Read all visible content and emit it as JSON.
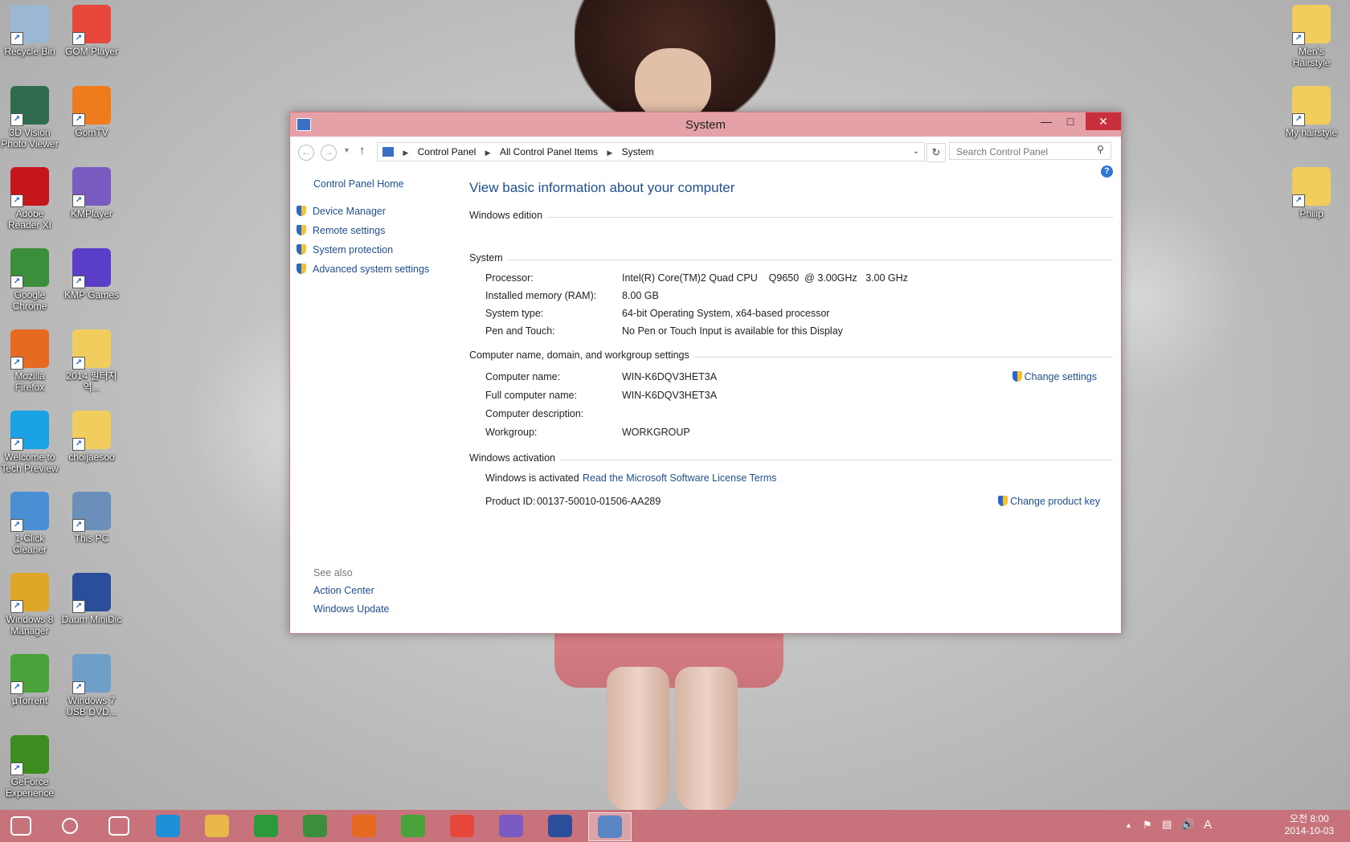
{
  "desktop": {
    "icons_left": [
      {
        "label": "Recycle Bin",
        "icon": "recycle-bin-icon",
        "color": "#9bb7d4"
      },
      {
        "label": "GOM Player",
        "icon": "gom-player-icon",
        "color": "#e8473b"
      },
      {
        "label": "3D Vision Photo Viewer",
        "icon": "3d-vision-icon",
        "color": "#2f6b4f"
      },
      {
        "label": "GomTV",
        "icon": "gomtv-icon",
        "color": "#f07b1d"
      },
      {
        "label": "Adobe Reader XI",
        "icon": "adobe-reader-icon",
        "color": "#c4161c"
      },
      {
        "label": "KMPlayer",
        "icon": "kmplayer-icon",
        "color": "#7a5bc2"
      },
      {
        "label": "Google Chrome",
        "icon": "chrome-icon",
        "color": "#3b8e3b"
      },
      {
        "label": "KMP Games",
        "icon": "kmp-games-icon",
        "color": "#5a3ec8"
      },
      {
        "label": "Mozilla Firefox",
        "icon": "firefox-icon",
        "color": "#e66a1f"
      },
      {
        "label": "2014 필터지역...",
        "icon": "folder-icon",
        "color": "#f0cd5c"
      },
      {
        "label": "Welcome to Tech Preview",
        "icon": "windows-logo-icon",
        "color": "#1aa1e6"
      },
      {
        "label": "choijaesoo",
        "icon": "user-folder-icon",
        "color": "#f0cd5c"
      },
      {
        "label": "1-Click Cleaner",
        "icon": "cleaner-icon",
        "color": "#4a8fd4"
      },
      {
        "label": "This PC",
        "icon": "this-pc-icon",
        "color": "#6a8fb8"
      },
      {
        "label": "Windows 8 Manager",
        "icon": "win8-manager-icon",
        "color": "#e0a628"
      },
      {
        "label": "Daum MiniDic",
        "icon": "daum-minidic-icon",
        "color": "#2a4e99"
      },
      {
        "label": "µTorrent",
        "icon": "utorrent-icon",
        "color": "#4aa23a"
      },
      {
        "label": "Windows 7 USB DVD...",
        "icon": "usb-dvd-tool-icon",
        "color": "#6f9fc9"
      },
      {
        "label": "GeForce Experience",
        "icon": "geforce-icon",
        "color": "#3c8c1f"
      }
    ],
    "icons_right": [
      {
        "label": "Men's Hairstyle",
        "icon": "folder-icon",
        "color": "#f0cd5c"
      },
      {
        "label": "My hairstyle",
        "icon": "folder-icon",
        "color": "#f0cd5c"
      },
      {
        "label": "Philip",
        "icon": "folder-icon",
        "color": "#f0cd5c"
      }
    ]
  },
  "window": {
    "title": "System",
    "address": {
      "crumbs": [
        "Control Panel",
        "All Control Panel Items",
        "System"
      ]
    },
    "search_placeholder": "Search Control Panel",
    "left": {
      "home": "Control Panel Home",
      "tasks": [
        "Device Manager",
        "Remote settings",
        "System protection",
        "Advanced system settings"
      ],
      "see_also": "See also",
      "links": [
        "Action Center",
        "Windows Update"
      ]
    },
    "main": {
      "heading": "View basic information about your computer",
      "edition_section": "Windows edition",
      "system_section": "System",
      "system_rows": [
        {
          "k": "Processor:",
          "v": "Intel(R) Core(TM)2 Quad CPU    Q9650  @ 3.00GHz   3.00 GHz"
        },
        {
          "k": "Installed memory (RAM):",
          "v": "8.00 GB"
        },
        {
          "k": "System type:",
          "v": "64-bit Operating System, x64-based processor"
        },
        {
          "k": "Pen and Touch:",
          "v": "No Pen or Touch Input is available for this Display"
        }
      ],
      "computer_section": "Computer name, domain, and workgroup settings",
      "computer_rows": [
        {
          "k": "Computer name:",
          "v": "WIN-K6DQV3HET3A"
        },
        {
          "k": "Full computer name:",
          "v": "WIN-K6DQV3HET3A"
        },
        {
          "k": "Computer description:",
          "v": ""
        },
        {
          "k": "Workgroup:",
          "v": "WORKGROUP"
        }
      ],
      "change_settings": "Change settings",
      "activation_section": "Windows activation",
      "activated_text": "Windows is activated",
      "license_link": "Read the Microsoft Software License Terms",
      "product_id_label": "Product ID:",
      "product_id": "00137-50010-01506-AA289",
      "change_product_key": "Change product key"
    }
  },
  "taskbar": {
    "apps": [
      {
        "icon": "start-windows-icon",
        "color": "#ffffff"
      },
      {
        "icon": "search-icon",
        "color": "#ffffff"
      },
      {
        "icon": "task-view-icon",
        "color": "#ffffff"
      },
      {
        "icon": "internet-explorer-icon",
        "color": "#1f8fd8"
      },
      {
        "icon": "file-explorer-icon",
        "color": "#e8b84a"
      },
      {
        "icon": "store-icon",
        "color": "#2a9a3a"
      },
      {
        "icon": "chrome-icon",
        "color": "#3b8e3b"
      },
      {
        "icon": "firefox-icon",
        "color": "#e66a1f"
      },
      {
        "icon": "utorrent-icon",
        "color": "#4aa23a"
      },
      {
        "icon": "gom-player-icon",
        "color": "#e8473b"
      },
      {
        "icon": "kmplayer-icon",
        "color": "#7a5bc2"
      },
      {
        "icon": "daum-minidic-icon",
        "color": "#2a4e99"
      },
      {
        "icon": "control-panel-icon",
        "color": "#5a86c4"
      }
    ],
    "ime": "A",
    "time": "오전 8:00",
    "date": "2014-10-03"
  }
}
